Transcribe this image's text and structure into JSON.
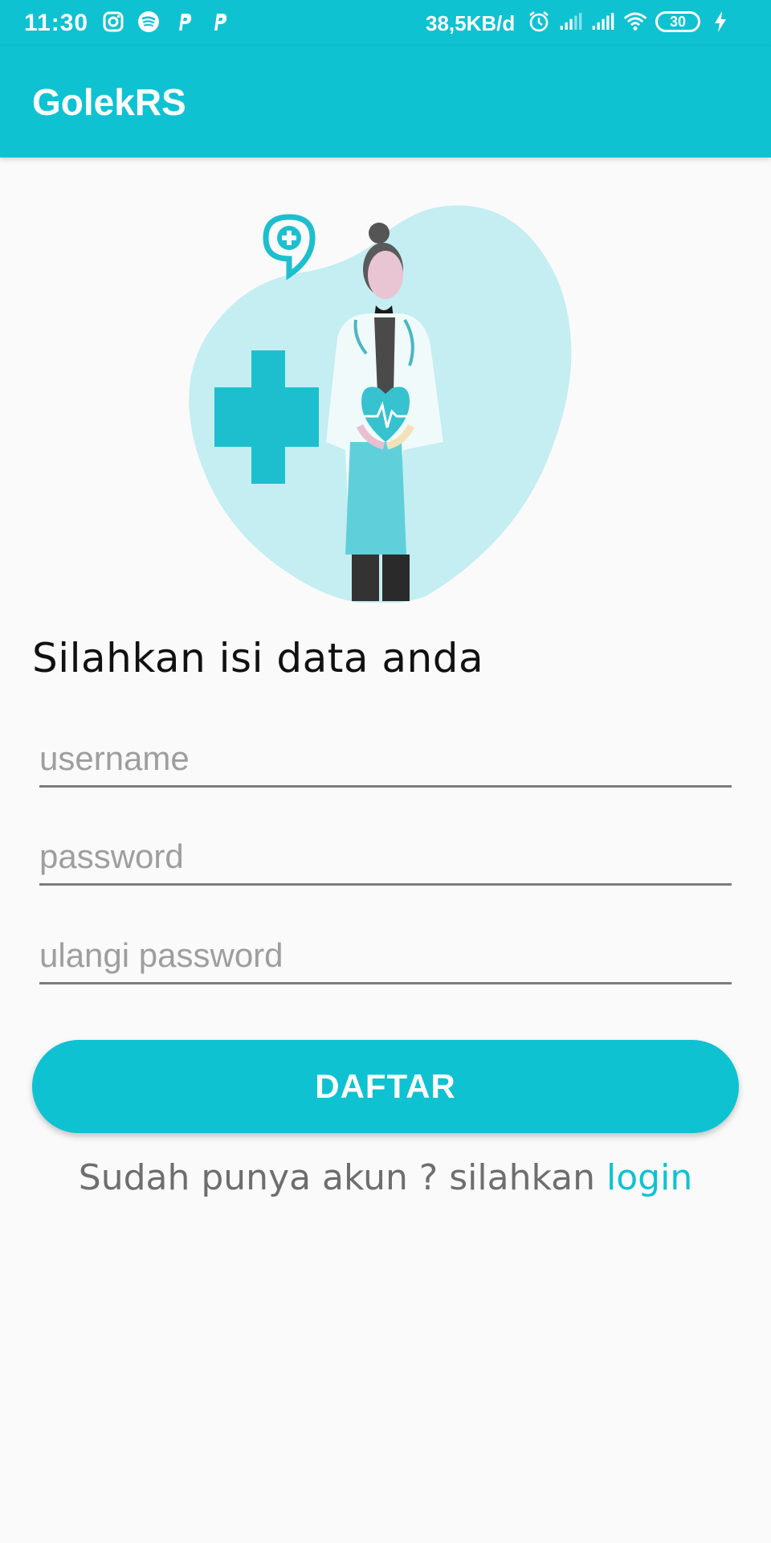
{
  "status_bar": {
    "time": "11:30",
    "left_icons": [
      "instagram-icon",
      "spotify-icon",
      "p-app-icon",
      "p-app-icon"
    ],
    "network_speed": "38,5KB/d",
    "battery_level": "30"
  },
  "app_bar": {
    "title": "GolekRS"
  },
  "form": {
    "prompt": "Silahkan isi data anda",
    "username_placeholder": "username",
    "password_placeholder": "password",
    "repeat_password_placeholder": "ulangi password",
    "submit_label": "DAFTAR"
  },
  "footer": {
    "text": "Sudah punya akun ? silahkan ",
    "link_label": "login"
  },
  "colors": {
    "primary": "#0ec2d2",
    "background": "#fafafa",
    "illustration_blob": "#c4eef1"
  }
}
